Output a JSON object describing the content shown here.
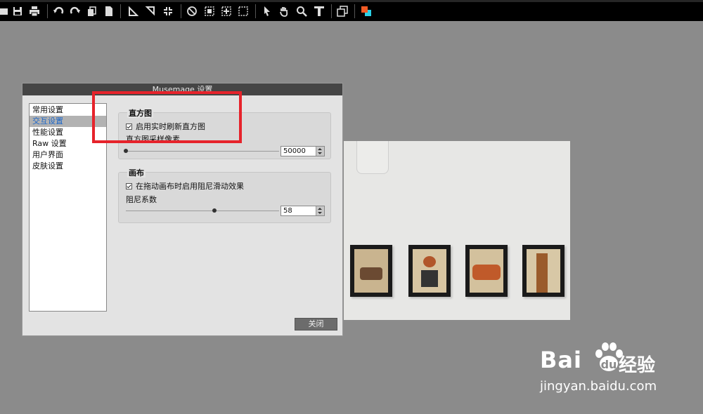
{
  "toolbar": {
    "icons": [
      "open-icon",
      "save-icon",
      "print-icon",
      "undo-icon",
      "redo-icon",
      "copy-icon",
      "page-icon",
      "rotate-left-icon",
      "rotate-right-icon",
      "fit-icon",
      "no-icon",
      "select-rect-icon",
      "crop-icon",
      "marquee-icon",
      "pointer-icon",
      "hand-icon",
      "zoom-icon",
      "text-icon",
      "layers-icon",
      "color-icon"
    ]
  },
  "dialog": {
    "title": "Musemage 设置",
    "categories": [
      "常用设置",
      "交互设置",
      "性能设置",
      "Raw 设置",
      "用户界面",
      "皮肤设置"
    ],
    "selected_index": 1,
    "histogram": {
      "title": "直方图",
      "checkbox_label": "启用实时刷新直方图",
      "checked": true,
      "slider_label": "直方图采样像素",
      "value": "50000",
      "slider_fraction": 0.0
    },
    "canvas": {
      "title": "画布",
      "checkbox_label": "在拖动画布时启用阻尼滑动效果",
      "checked": true,
      "slider_label": "阻尼系数",
      "value": "58",
      "slider_fraction": 0.58
    },
    "close_label": "关闭"
  },
  "watermark": {
    "brand": "Bai",
    "brand_suffix": "经验",
    "url": "jingyan.baidu.com"
  },
  "colors": {
    "highlight_box": "#e6232b",
    "selected_text": "#1b66c9"
  }
}
